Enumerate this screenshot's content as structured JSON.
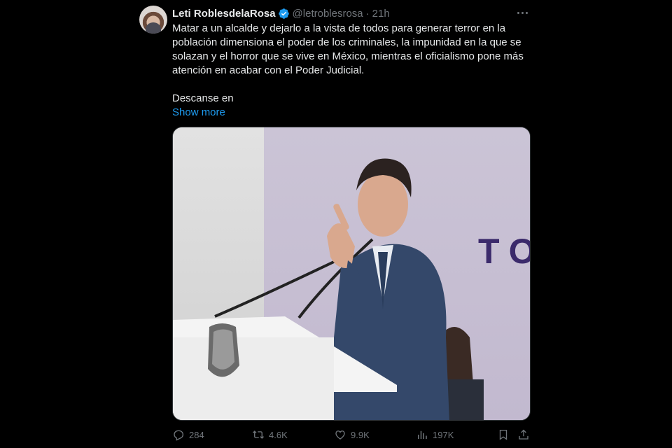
{
  "tweet": {
    "author_name": "Leti RoblesdelaRosa",
    "handle": "@letroblesrosa",
    "separator": "·",
    "time": "21h",
    "text_paragraph_1": "Matar a un alcalde y dejarlo a la vista de todos para generar terror en la población dimensiona el poder de los criminales, la impunidad en la que se solazan y el horror que se vive en México, mientras el oficialismo pone más atención en acabar con el Poder Judicial.",
    "text_paragraph_2": "Descanse en",
    "show_more": "Show more",
    "image_background_text": "TO",
    "metrics": {
      "replies": "284",
      "reposts": "4.6K",
      "likes": "9.9K",
      "views": "197K"
    }
  },
  "colors": {
    "background": "#000000",
    "text": "#e7e9ea",
    "muted": "#71767b",
    "link": "#1d9bf0",
    "verified": "#1d9bf0"
  },
  "icons": [
    "more-icon",
    "verified-badge-icon",
    "reply-icon",
    "repost-icon",
    "like-icon",
    "views-icon",
    "bookmark-icon",
    "share-icon"
  ]
}
